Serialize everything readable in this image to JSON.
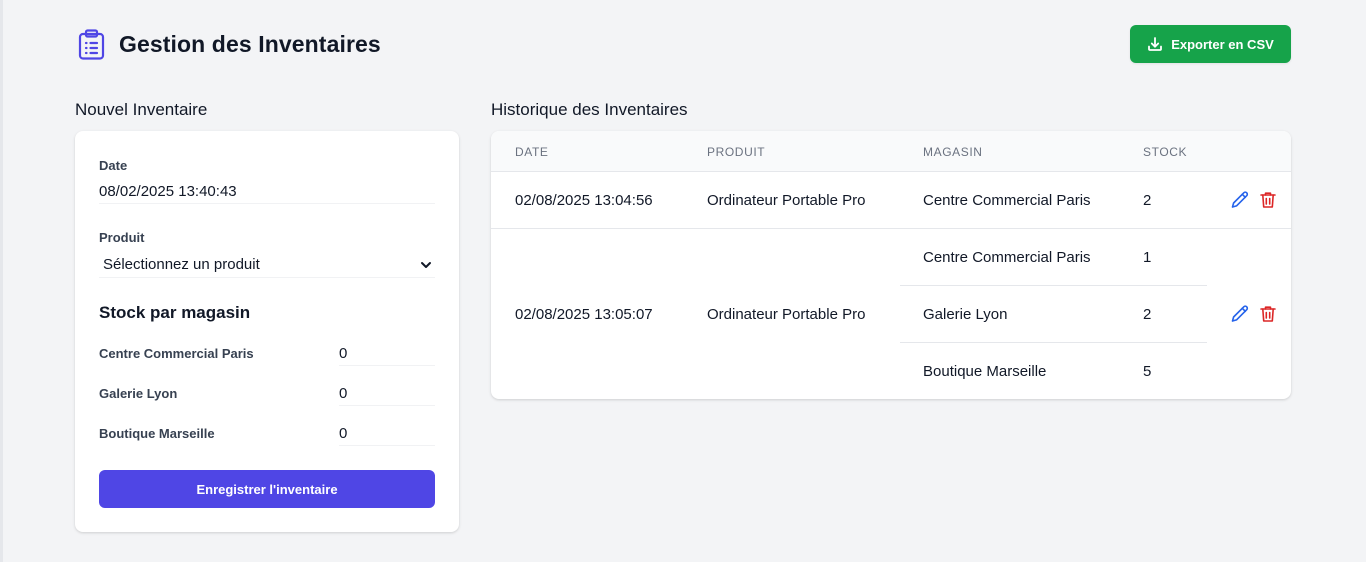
{
  "header": {
    "title": "Gestion des Inventaires",
    "icon": "clipboard-list-icon",
    "export_label": "Exporter en CSV",
    "export_icon": "download-icon"
  },
  "form": {
    "section_title": "Nouvel Inventaire",
    "date_label": "Date",
    "date_value": "08/02/2025 13:40:43",
    "product_label": "Produit",
    "product_selected": "Sélectionnez un produit",
    "stock_heading": "Stock par magasin",
    "stores": [
      {
        "name": "Centre Commercial Paris",
        "qty": "0"
      },
      {
        "name": "Galerie Lyon",
        "qty": "0"
      },
      {
        "name": "Boutique Marseille",
        "qty": "0"
      }
    ],
    "save_label": "Enregistrer l'inventaire"
  },
  "history": {
    "section_title": "Historique des Inventaires",
    "columns": [
      "DATE",
      "PRODUIT",
      "MAGASIN",
      "STOCK"
    ],
    "rows": [
      {
        "date": "02/08/2025 13:04:56",
        "product": "Ordinateur Portable Pro",
        "entries": [
          {
            "store": "Centre Commercial Paris",
            "stock": "2"
          }
        ]
      },
      {
        "date": "02/08/2025 13:05:07",
        "product": "Ordinateur Portable Pro",
        "entries": [
          {
            "store": "Centre Commercial Paris",
            "stock": "1"
          },
          {
            "store": "Galerie Lyon",
            "stock": "2"
          },
          {
            "store": "Boutique Marseille",
            "stock": "5"
          }
        ]
      }
    ]
  },
  "colors": {
    "accent": "#4f46e5",
    "export": "#16a34a",
    "edit": "#2563eb",
    "delete": "#dc2626",
    "background": "#f3f4f6"
  }
}
